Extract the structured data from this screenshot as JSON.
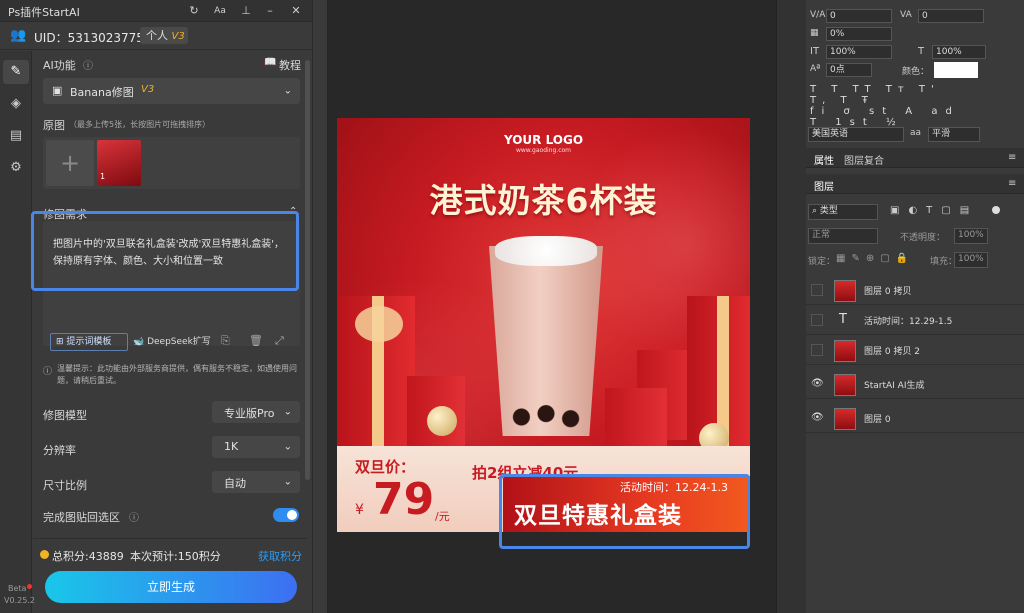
{
  "plugin": {
    "title": "Ps插件StartAI",
    "uid_label": "UID：5313023775",
    "plan_label": "个人",
    "plan_version": "V3",
    "ai_function_label": "AI功能",
    "tutorial_label": "教程",
    "ai_function_value": "Banana修图",
    "ai_function_version": "V3",
    "source_label": "原图",
    "source_hint": "（最多上传5张，长按图片可拖拽排序）",
    "thumb_count": "1",
    "edit_req_label": "修图需求",
    "edit_req_text": "把图片中的'双旦联名礼盒装'改成'双旦特惠礼盒装'，保持原有字体、颜色、大小和位置一致",
    "prompt_template_btn": "提示词模板",
    "deepseek_btn": "DeepSeek扩写",
    "notice": "温馨提示：此功能由外部服务商提供，偶有服务不稳定，如遇使用问题，请稍后重试。",
    "model_label": "修图模型",
    "model_value": "专业版Pro",
    "resolution_label": "分辨率",
    "resolution_value": "1K",
    "ratio_label": "尺寸比例",
    "ratio_value": "自动",
    "paste_back_label": "完成图贴回选区",
    "total_points": "总积分:43889",
    "estimate": "本次预计:150积分",
    "get_points": "获取积分",
    "generate_btn": "立即生成",
    "beta_label": "Beta",
    "version_label": "V0.25.2"
  },
  "poster": {
    "logo": "YOUR LOGO",
    "logo_sub": "www.gaoding.com",
    "headline": "港式奶茶6杯装",
    "price_label": "双旦价：",
    "price_currency": "¥",
    "price_value": "79",
    "price_unit": "/元",
    "promo_hidden": "拍2组立减40元",
    "activity_time": "活动时间：12.24-1.3",
    "gift_box_title": "双旦特惠礼盒装"
  },
  "right_panel": {
    "field_va": "0",
    "field_tracking": "0",
    "field_percent": "0%",
    "vscale": "100%",
    "hscale": "100%",
    "baseline": "0点",
    "color_label": "颜色：",
    "lang": "美国英语",
    "aa": "平滑",
    "tab_props": "属性",
    "tab_comp": "图层复合",
    "tab_layers": "图层",
    "filter_kind": "类型",
    "blend": "正常",
    "opacity_label": "不透明度：",
    "opacity_val": "100%",
    "lock_label": "锁定：",
    "fill_label": "填充：",
    "fill_val": "100%",
    "layers": [
      {
        "name": "图层 0 拷贝",
        "type": "image",
        "visible": false
      },
      {
        "name": "活动时间：12.29-1.5",
        "type": "text",
        "visible": false
      },
      {
        "name": "图层 0 拷贝 2",
        "type": "image",
        "visible": false
      },
      {
        "name": "StartAI AI生成",
        "type": "image",
        "visible": true
      },
      {
        "name": "图层 0",
        "type": "image",
        "visible": true
      }
    ]
  },
  "colors": {
    "accent": "#2f8cf0",
    "highlight": "#4a86e8",
    "gold": "#f0b323",
    "poster_red": "#c71b22"
  }
}
